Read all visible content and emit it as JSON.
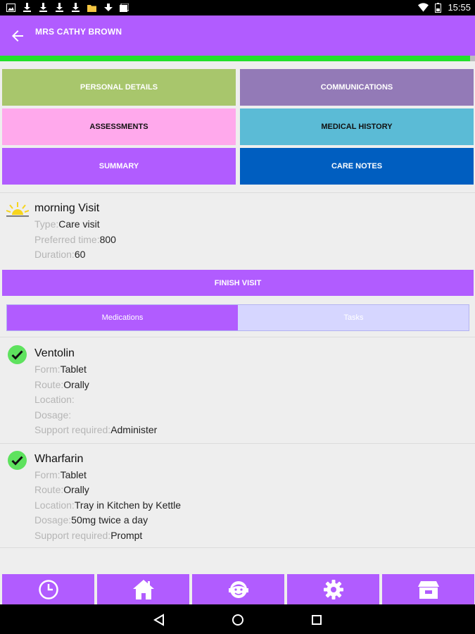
{
  "status_bar": {
    "time": "15:55",
    "left_icons": [
      "gallery-icon",
      "download-icon",
      "download-icon",
      "download-icon",
      "download-icon",
      "folder-icon",
      "download-icon",
      "photos-icon"
    ],
    "right_icons": [
      "wifi-icon",
      "battery-icon"
    ]
  },
  "app_bar": {
    "title": "MRS CATHY BROWN",
    "back_icon": "back-arrow-icon",
    "progress": 0.99,
    "color": "#b15cff"
  },
  "sections": [
    {
      "label": "PERSONAL DETAILS",
      "color": "#a8c66c"
    },
    {
      "label": "COMMUNICATIONS",
      "color": "#937ab7"
    },
    {
      "label": "ASSESSMENTS",
      "color": "#ffa9ec"
    },
    {
      "label": "MEDICAL HISTORY",
      "color": "#5bbbd6"
    },
    {
      "label": "SUMMARY",
      "color": "#b15cff"
    },
    {
      "label": "CARE NOTES",
      "color": "#005ec0"
    }
  ],
  "visit": {
    "icon": "sun-icon",
    "title": "morning Visit",
    "fields": [
      {
        "label": "Type:",
        "value": "Care visit"
      },
      {
        "label": "Preferred time:",
        "value": "800"
      },
      {
        "label": "Duration:",
        "value": "60"
      }
    ]
  },
  "finish_button": "FINISH VISIT",
  "tabs": [
    {
      "label": "Medications",
      "active": true
    },
    {
      "label": "Tasks",
      "active": false
    }
  ],
  "medications": [
    {
      "name": "Ventolin",
      "status_icon": "checkmark-icon",
      "fields": [
        {
          "label": "Form:",
          "value": "Tablet"
        },
        {
          "label": "Route:",
          "value": "Orally"
        },
        {
          "label": "Location:",
          "value": ""
        },
        {
          "label": "Dosage:",
          "value": ""
        },
        {
          "label": "Support required:",
          "value": "Administer"
        }
      ]
    },
    {
      "name": "Wharfarin",
      "status_icon": "checkmark-icon",
      "fields": [
        {
          "label": "Form:",
          "value": "Tablet"
        },
        {
          "label": "Route:",
          "value": "Orally"
        },
        {
          "label": "Location:",
          "value": "Tray in Kitchen by Kettle"
        },
        {
          "label": "Dosage:",
          "value": "50mg twice a day"
        },
        {
          "label": "Support required:",
          "value": "Prompt"
        }
      ]
    }
  ],
  "bottom_nav": [
    "clock-icon",
    "home-icon",
    "user-face-icon",
    "settings-gear-icon",
    "open-box-icon"
  ],
  "system_nav": [
    "back-triangle-icon",
    "home-circle-icon",
    "recents-square-icon"
  ]
}
